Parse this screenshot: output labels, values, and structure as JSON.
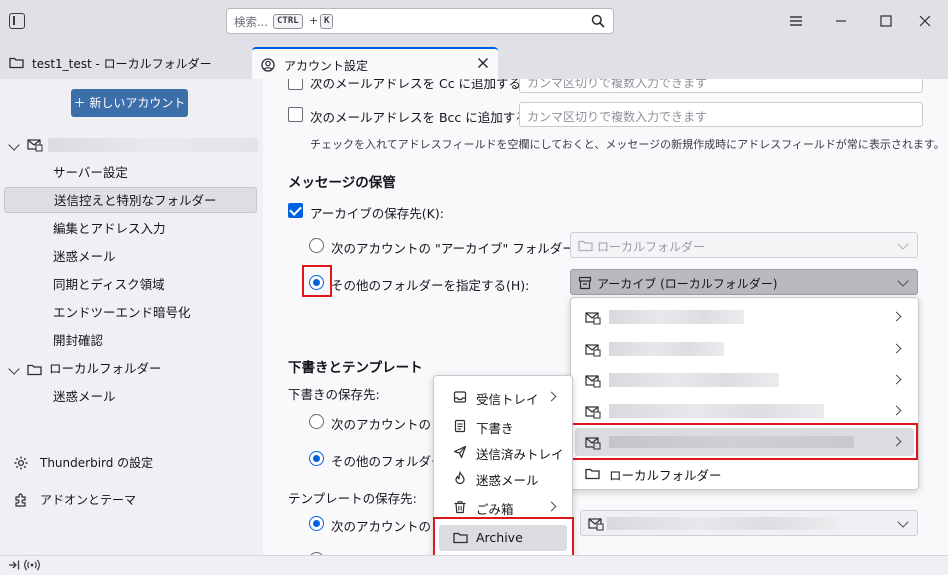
{
  "titlebar": {
    "search_placeholder": "検索...",
    "kbd_ctrl": "CTRL",
    "kbd_plus": "+",
    "kbd_k": "K"
  },
  "tabs": [
    {
      "label": "test1_test - ローカルフォルダー",
      "icon": "folder-icon"
    },
    {
      "label": "アカウント設定",
      "icon": "account-settings-icon",
      "active": true
    }
  ],
  "sidebar": {
    "new_account_label": "＋ 新しいアカウント",
    "items": [
      {
        "label": "サーバー設定"
      },
      {
        "label": "送信控えと特別なフォルダー",
        "selected": true
      },
      {
        "label": "編集とアドレス入力"
      },
      {
        "label": "迷惑メール"
      },
      {
        "label": "同期とディスク領域"
      },
      {
        "label": "エンドツーエンド暗号化"
      },
      {
        "label": "開封確認"
      }
    ],
    "local_folders_label": "ローカルフォルダー",
    "local_items": [
      {
        "label": "迷惑メール"
      }
    ],
    "thunderbird_settings_label": "Thunderbird の設定",
    "addons_label": "アドオンとテーマ"
  },
  "content": {
    "cc_label": "次のメールアドレスを Cc に追加する(C):",
    "cc_placeholder": "カンマ区切りで複数入力できます",
    "bcc_label": "次のメールアドレスを Bcc に追加する(B):",
    "bcc_placeholder": "カンマ区切りで複数入力できます",
    "address_hint": "チェックを入れてアドレスフィールドを空欄にしておくと、メッセージの新規作成時にアドレスフィールドが常に表示されます。",
    "archive_heading": "メッセージの保管",
    "archive_checkbox_label": "アーカイブの保存先(K):",
    "archive_radio1_label": "次のアカウントの \"アーカイブ\" フォルダー(N):",
    "archive_select1_value": "ローカルフォルダー",
    "archive_radio2_label": "その他のフォルダーを指定する(H):",
    "archive_select2_value": "アーカイブ (ローカルフォルダー)",
    "drafts_heading": "下書きとテンプレート",
    "drafts_location_label": "下書きの保存先:",
    "drafts_radio1_label": "次のアカウントの \"下",
    "drafts_radio2_label": "その他のフォルダーを",
    "templates_location_label": "テンプレートの保存先:",
    "templates_radio1_label": "次のアカウントの \"テ"
  },
  "dropdown": {
    "last_item_label": "ローカルフォルダー"
  },
  "context_menu": {
    "items": [
      {
        "label": "受信トレイ",
        "icon": "inbox-icon",
        "submenu": true
      },
      {
        "label": "下書き",
        "icon": "draft-icon",
        "submenu": false
      },
      {
        "label": "送信済みトレイ",
        "icon": "sent-icon",
        "submenu": false
      },
      {
        "label": "迷惑メール",
        "icon": "junk-icon",
        "submenu": false
      },
      {
        "label": "ごみ箱",
        "icon": "trash-icon",
        "submenu": true
      },
      {
        "label": "Archive",
        "icon": "folder-icon",
        "submenu": false
      }
    ]
  },
  "colors": {
    "accent": "#0061e0",
    "highlight_red": "#e0161b",
    "new_account_button": "#3c6ea9"
  }
}
